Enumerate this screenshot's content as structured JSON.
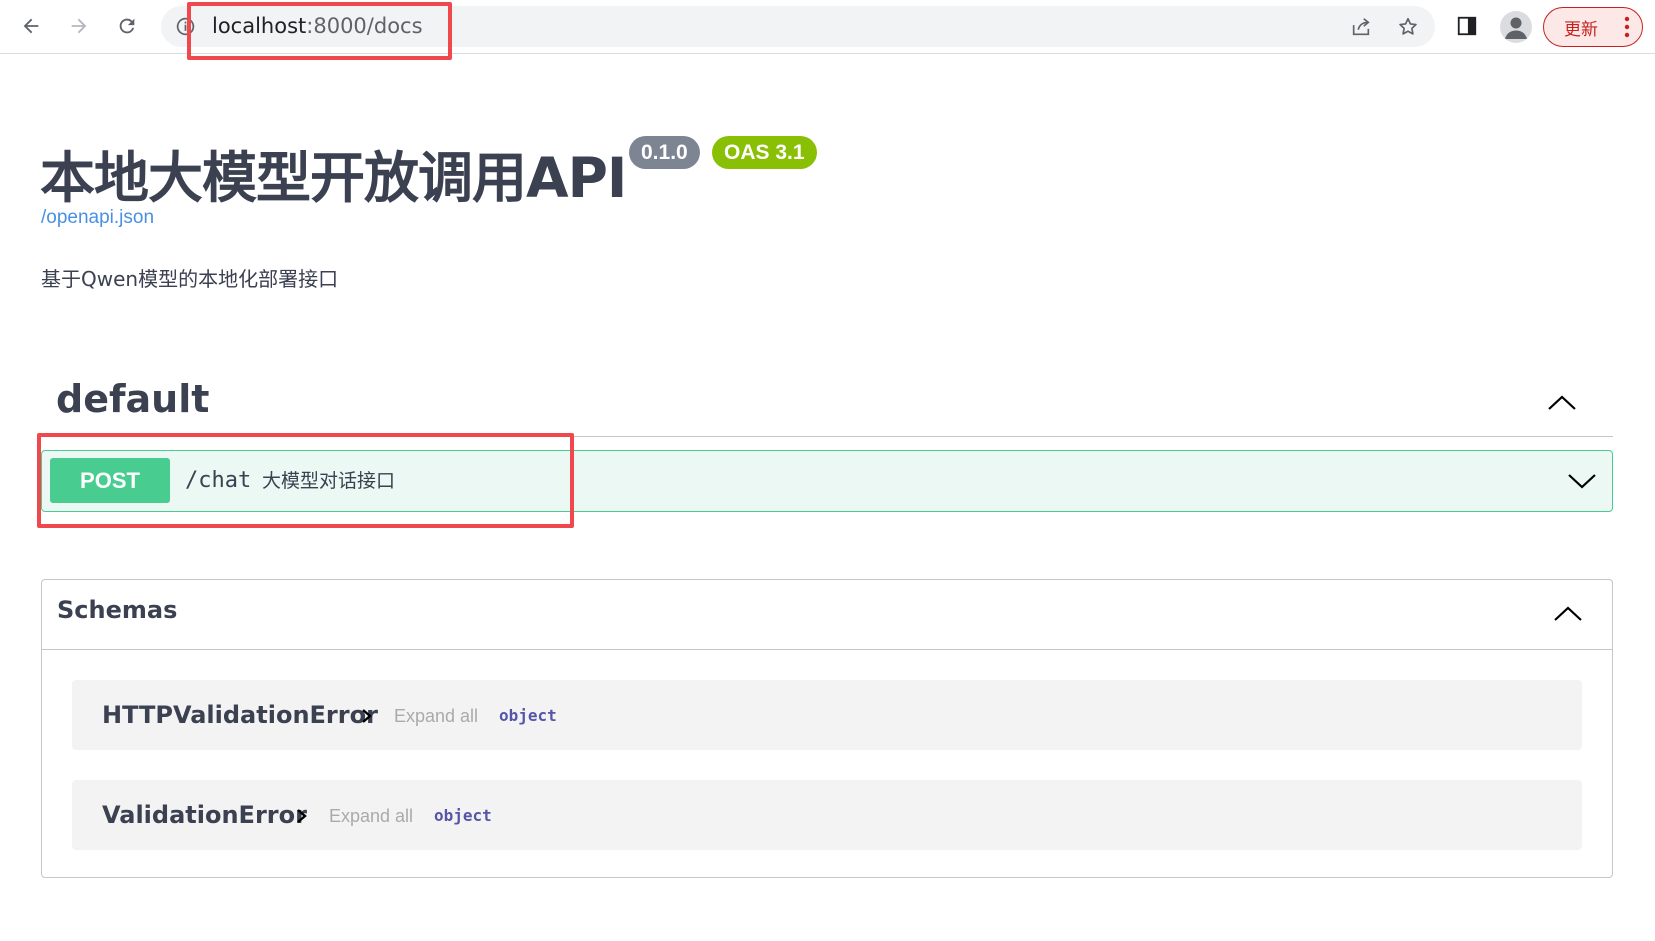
{
  "browser": {
    "url_host": "localhost",
    "url_rest": ":8000/docs",
    "update_label": "更新"
  },
  "info": {
    "title": "本地大模型开放调用API",
    "version": "0.1.0",
    "oas_version": "OAS 3.1",
    "spec_link": "/openapi.json",
    "description": "基于Qwen模型的本地化部署接口"
  },
  "tag": {
    "name": "default"
  },
  "operation": {
    "method": "POST",
    "path": "/chat",
    "summary": "大模型对话接口"
  },
  "schemas": {
    "title": "Schemas",
    "models": [
      {
        "name": "HTTPValidationError",
        "expand_label": "Expand all",
        "type": "object"
      },
      {
        "name": "ValidationError",
        "expand_label": "Expand all",
        "type": "object"
      }
    ]
  },
  "colors": {
    "post_method": "#49cc90",
    "post_block_bg": "#ebf8f3",
    "highlight_box": "#f0494d",
    "version_badge": "#7d8492",
    "oas_badge": "#89bf04",
    "link": "#4990e2"
  }
}
